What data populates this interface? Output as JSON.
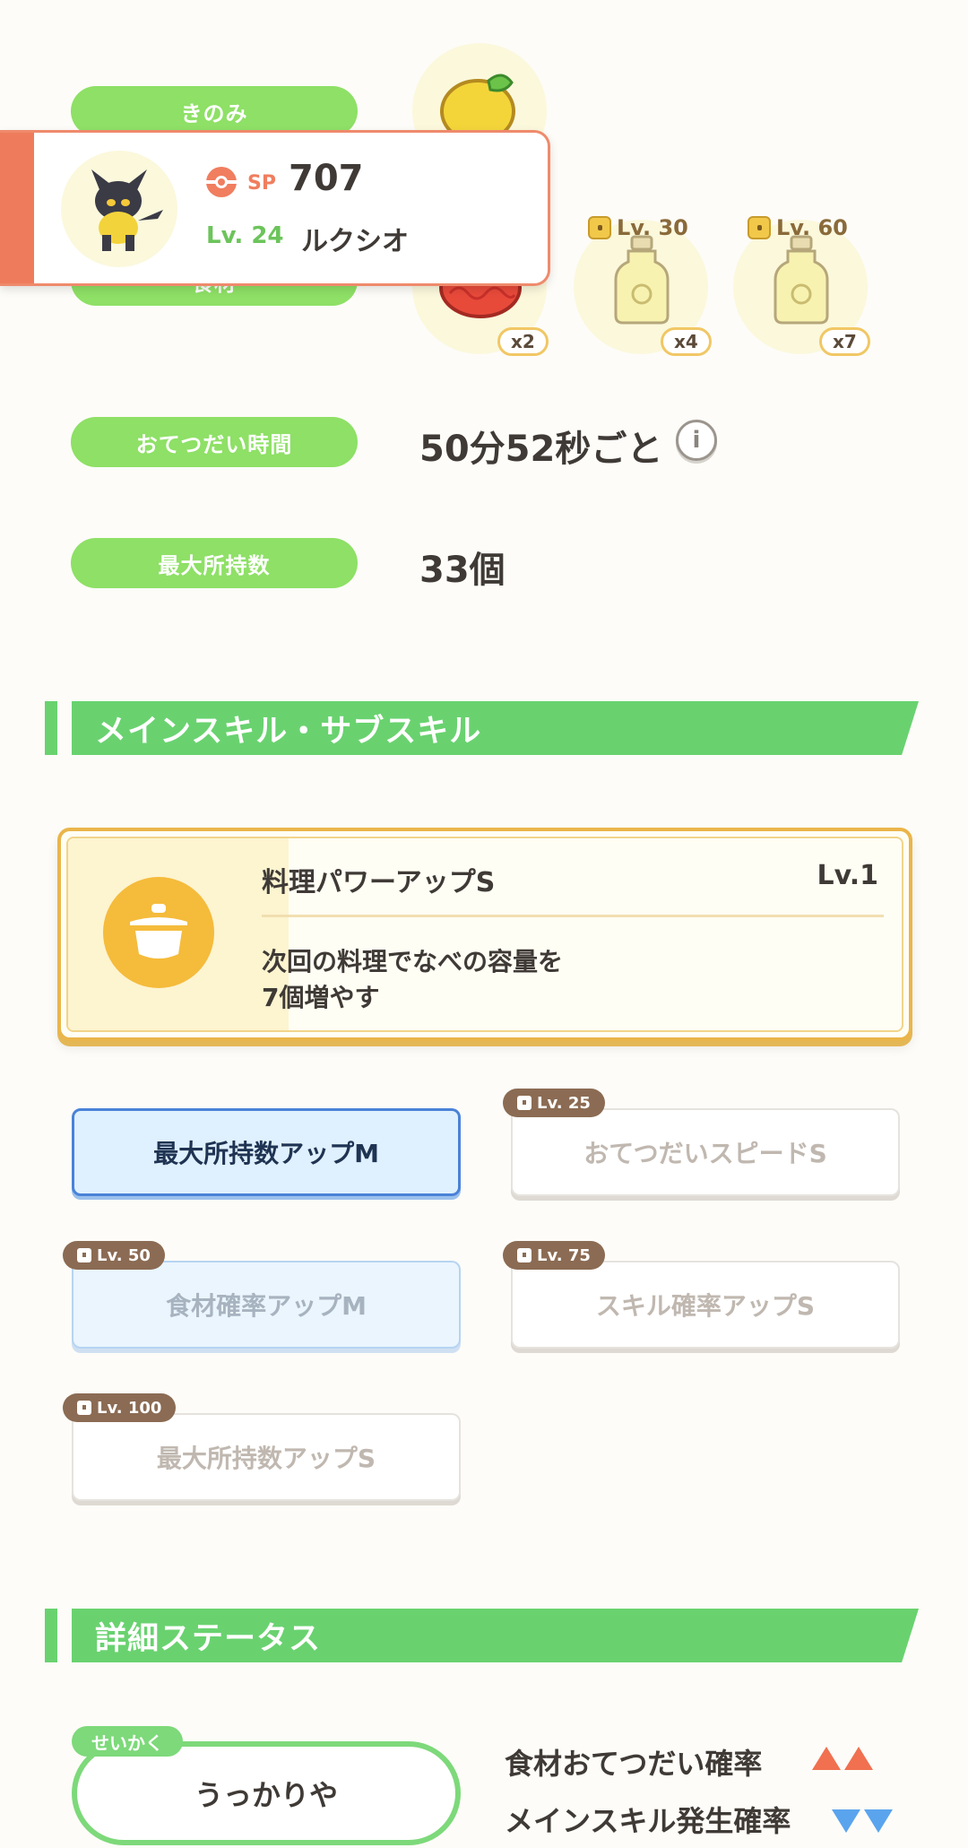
{
  "production": {
    "berry_label": "きのみ",
    "ingredient_label": "食材",
    "ingredient_slots": [
      {
        "count": "x2"
      },
      {
        "unlock": "Lv. 30",
        "count": "x4"
      },
      {
        "unlock": "Lv. 60",
        "count": "x7"
      }
    ],
    "help_time_label": "おてつだい時間",
    "help_time_value": "50分52秒ごと",
    "max_carry_label": "最大所持数",
    "max_carry_value": "33個"
  },
  "pokemon_card": {
    "sp_label": "SP",
    "sp_value": "707",
    "level": "Lv. 24",
    "name": "ルクシオ"
  },
  "skills_section": {
    "title": "メインスキル・サブスキル",
    "main_skill": {
      "name": "料理パワーアップS",
      "level": "Lv.1",
      "description_line1": "次回の料理でなべの容量を",
      "description_line2": "7個増やす"
    },
    "sub_skills": [
      {
        "label": "最大所持数アップM",
        "unlock": ""
      },
      {
        "label": "おてつだいスピードS",
        "unlock": "Lv. 25"
      },
      {
        "label": "食材確率アップM",
        "unlock": "Lv. 50"
      },
      {
        "label": "スキル確率アップS",
        "unlock": "Lv. 75"
      },
      {
        "label": "最大所持数アップS",
        "unlock": "Lv. 100"
      }
    ]
  },
  "details_section": {
    "title": "詳細ステータス",
    "nature_label": "せいかく",
    "nature_value": "うっかりや",
    "stat_up": "食材おてつだい確率",
    "stat_down": "メインスキル発生確率"
  },
  "colors": {
    "accent_green": "#69d26f",
    "card_orange": "#ee7c5c",
    "skill_gold": "#eab54a",
    "up_arrow": "#f07050",
    "down_arrow": "#5aa4ee"
  },
  "icons": [
    "pokeball-icon",
    "berry-icon",
    "tomato-icon",
    "oil-bottle-icon",
    "lock-icon",
    "info-icon",
    "cooking-pot-icon"
  ]
}
